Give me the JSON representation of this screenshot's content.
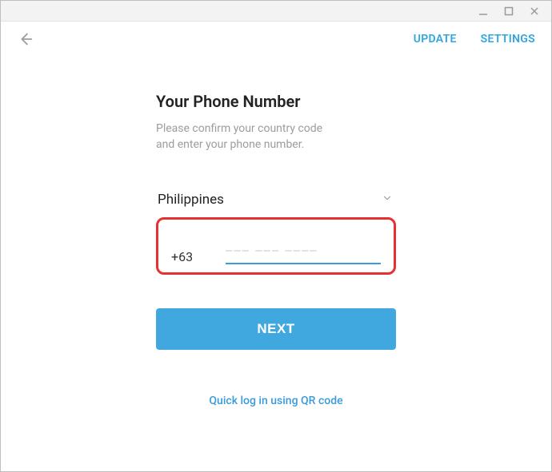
{
  "header": {
    "update": "UPDATE",
    "settings": "SETTINGS"
  },
  "main": {
    "title": "Your Phone Number",
    "subtitle_line1": "Please confirm your country code",
    "subtitle_line2": "and enter your phone number.",
    "country": "Philippines",
    "country_code": "+63",
    "phone_placeholder": "––– ––– ––––",
    "next_label": "NEXT",
    "qr_link": "Quick log in using QR code"
  },
  "colors": {
    "accent": "#41a8df",
    "link": "#2fa6e0",
    "highlight_border": "#e73131"
  }
}
